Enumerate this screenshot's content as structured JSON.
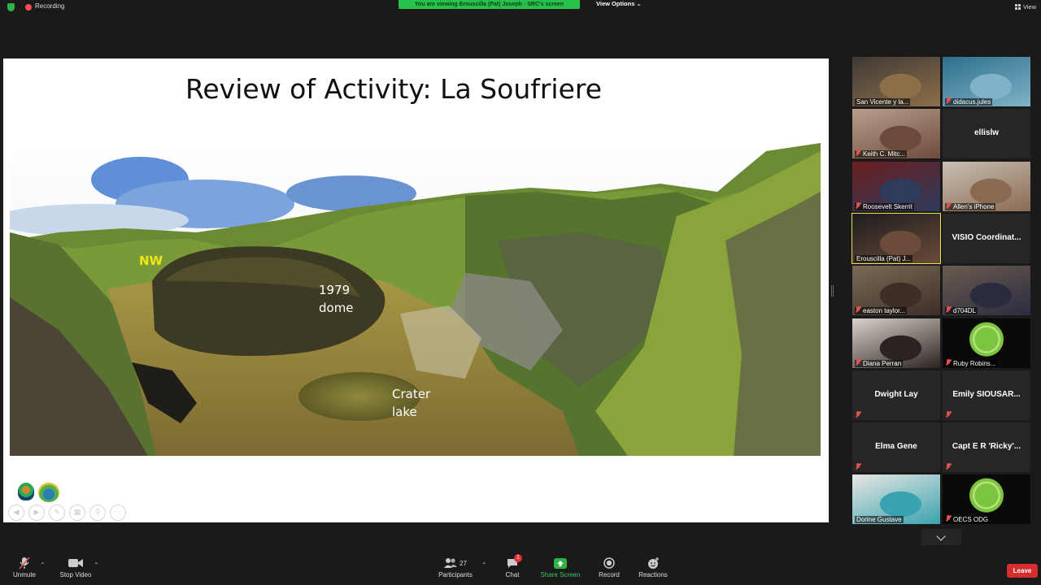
{
  "topbar": {
    "recording_label": "Recording",
    "viewing_banner": "You are viewing Erouscilla (Pat) Joseph - SRC's screen",
    "view_options_label": "View Options",
    "view_label": "View"
  },
  "slide": {
    "title": "Review of Activity: La Soufriere",
    "labels": {
      "nw": "NW",
      "dome_line1": "1979",
      "dome_line2": "dome",
      "lake_line1": "Crater",
      "lake_line2": "lake"
    }
  },
  "participants": [
    {
      "name": "San Vicente y la...",
      "muted": false,
      "video": true
    },
    {
      "name": "didacus.jules",
      "muted": true,
      "video": true
    },
    {
      "name": "Keith C. Mitc...",
      "muted": true,
      "video": true
    },
    {
      "name": "ellislw",
      "muted": false,
      "video": false
    },
    {
      "name": "Roosevelt Skerrit",
      "muted": true,
      "video": true
    },
    {
      "name": "Allen's iPhone",
      "muted": true,
      "video": true
    },
    {
      "name": "Erouscilla (Pat) J...",
      "muted": false,
      "video": true,
      "active_speaker": true
    },
    {
      "name": "VISIO  Coordinat...",
      "muted": false,
      "video": false
    },
    {
      "name": "easton taylor...",
      "muted": true,
      "video": true
    },
    {
      "name": "d704DL",
      "muted": true,
      "video": true
    },
    {
      "name": "Diana Perran",
      "muted": true,
      "video": true
    },
    {
      "name": "Ruby Robins...",
      "muted": true,
      "video": true
    },
    {
      "name": "Dwight Lay",
      "muted": true,
      "video": false
    },
    {
      "name": "Emily  SIOUSAR...",
      "muted": true,
      "video": false
    },
    {
      "name": "Elma Gene",
      "muted": true,
      "video": false
    },
    {
      "name": "Capt  E R  'Ricky'...",
      "muted": true,
      "video": false
    },
    {
      "name": "Dorine Gustave",
      "muted": false,
      "video": true
    },
    {
      "name": "OECS ODG",
      "muted": true,
      "video": true
    }
  ],
  "toolbar": {
    "unmute_label": "Unmute",
    "stop_video_label": "Stop Video",
    "participants_label": "Participants",
    "participants_count": "27",
    "chat_label": "Chat",
    "chat_badge": "1",
    "share_screen_label": "Share Screen",
    "record_label": "Record",
    "reactions_label": "Reactions",
    "leave_label": "Leave"
  },
  "colors": {
    "background": "#1a1a1a",
    "banner_green": "#27c24c",
    "active_speaker": "#e9e34a",
    "muted_red": "#e05252",
    "leave_red": "#d62e2e",
    "nw_label": "#f3e60f"
  }
}
